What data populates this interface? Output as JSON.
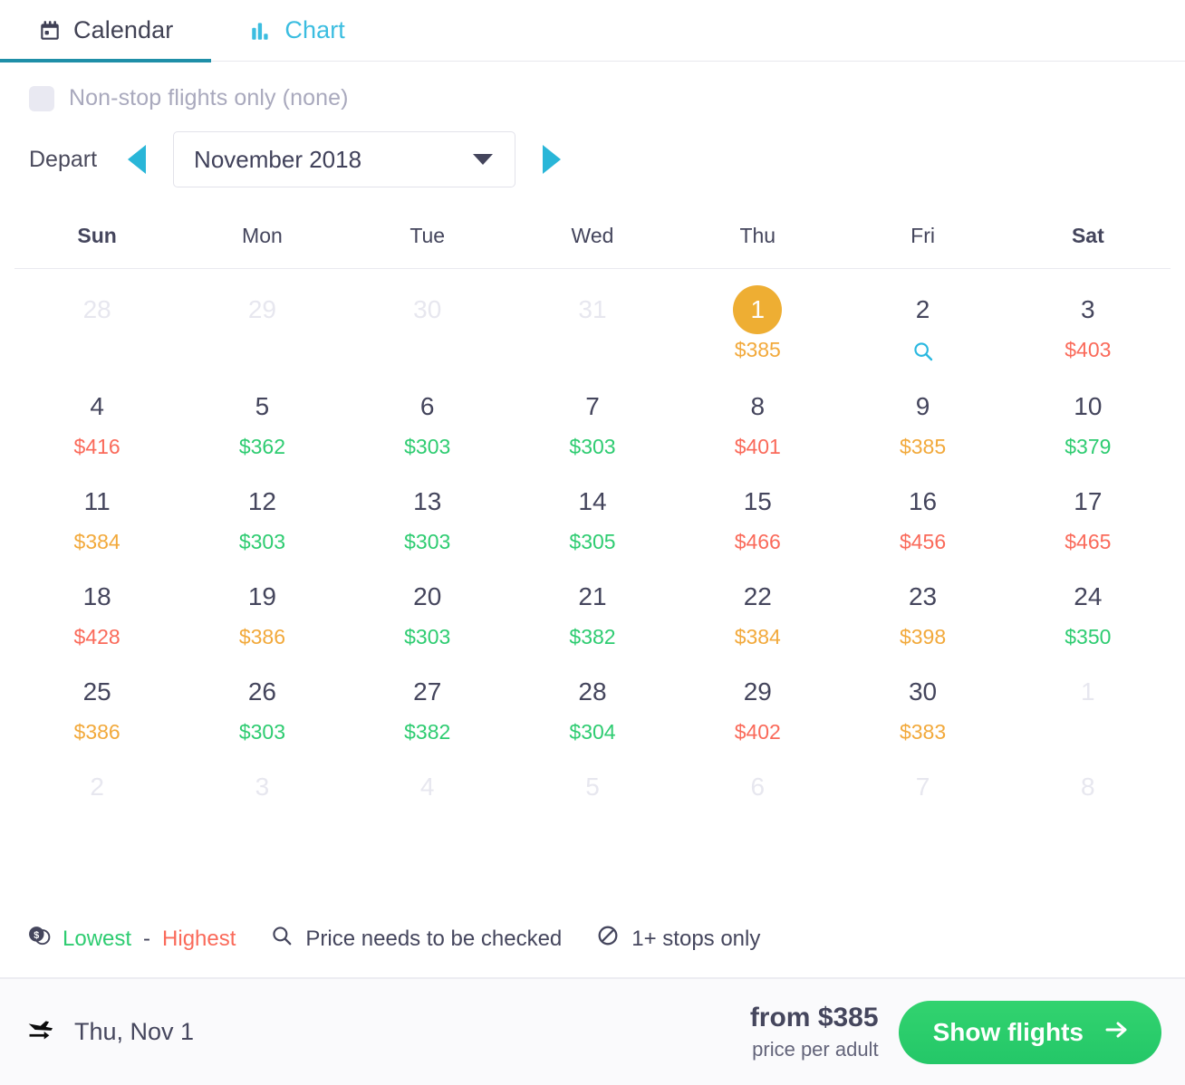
{
  "tabs": [
    {
      "label": "Calendar",
      "icon": "calendar-icon",
      "active": true
    },
    {
      "label": "Chart",
      "icon": "bar-chart-icon",
      "active": false
    }
  ],
  "filter": {
    "label": "Non-stop flights only (none)",
    "checked": false
  },
  "month_nav": {
    "depart_label": "Depart",
    "prev_icon": "triangle-left-icon",
    "next_icon": "triangle-right-icon",
    "selected_month": "November 2018",
    "caret_icon": "chevron-down-icon"
  },
  "calendar": {
    "day_headers": [
      "Sun",
      "Mon",
      "Tue",
      "Wed",
      "Thu",
      "Fri",
      "Sat"
    ],
    "weeks": [
      [
        {
          "day": "28",
          "price": "",
          "state": "muted"
        },
        {
          "day": "29",
          "price": "",
          "state": "muted"
        },
        {
          "day": "30",
          "price": "",
          "state": "muted"
        },
        {
          "day": "31",
          "price": "",
          "state": "muted"
        },
        {
          "day": "1",
          "price": "$385",
          "state": "selected",
          "tone": "sel"
        },
        {
          "day": "2",
          "price": "",
          "state": "normal",
          "icon": "search-icon"
        },
        {
          "day": "3",
          "price": "$403",
          "state": "normal",
          "tone": "high"
        }
      ],
      [
        {
          "day": "4",
          "price": "$416",
          "state": "normal",
          "tone": "high"
        },
        {
          "day": "5",
          "price": "$362",
          "state": "normal",
          "tone": "low"
        },
        {
          "day": "6",
          "price": "$303",
          "state": "normal",
          "tone": "low"
        },
        {
          "day": "7",
          "price": "$303",
          "state": "normal",
          "tone": "low"
        },
        {
          "day": "8",
          "price": "$401",
          "state": "normal",
          "tone": "high"
        },
        {
          "day": "9",
          "price": "$385",
          "state": "normal",
          "tone": "mid"
        },
        {
          "day": "10",
          "price": "$379",
          "state": "normal",
          "tone": "low"
        }
      ],
      [
        {
          "day": "11",
          "price": "$384",
          "state": "normal",
          "tone": "mid"
        },
        {
          "day": "12",
          "price": "$303",
          "state": "normal",
          "tone": "low"
        },
        {
          "day": "13",
          "price": "$303",
          "state": "normal",
          "tone": "low"
        },
        {
          "day": "14",
          "price": "$305",
          "state": "normal",
          "tone": "low"
        },
        {
          "day": "15",
          "price": "$466",
          "state": "normal",
          "tone": "high"
        },
        {
          "day": "16",
          "price": "$456",
          "state": "normal",
          "tone": "high"
        },
        {
          "day": "17",
          "price": "$465",
          "state": "normal",
          "tone": "high"
        }
      ],
      [
        {
          "day": "18",
          "price": "$428",
          "state": "normal",
          "tone": "high"
        },
        {
          "day": "19",
          "price": "$386",
          "state": "normal",
          "tone": "mid"
        },
        {
          "day": "20",
          "price": "$303",
          "state": "normal",
          "tone": "low"
        },
        {
          "day": "21",
          "price": "$382",
          "state": "normal",
          "tone": "low"
        },
        {
          "day": "22",
          "price": "$384",
          "state": "normal",
          "tone": "mid"
        },
        {
          "day": "23",
          "price": "$398",
          "state": "normal",
          "tone": "mid"
        },
        {
          "day": "24",
          "price": "$350",
          "state": "normal",
          "tone": "low"
        }
      ],
      [
        {
          "day": "25",
          "price": "$386",
          "state": "normal",
          "tone": "mid"
        },
        {
          "day": "26",
          "price": "$303",
          "state": "normal",
          "tone": "low"
        },
        {
          "day": "27",
          "price": "$382",
          "state": "normal",
          "tone": "low"
        },
        {
          "day": "28",
          "price": "$304",
          "state": "normal",
          "tone": "low"
        },
        {
          "day": "29",
          "price": "$402",
          "state": "normal",
          "tone": "high"
        },
        {
          "day": "30",
          "price": "$383",
          "state": "normal",
          "tone": "mid"
        },
        {
          "day": "1",
          "price": "",
          "state": "muted"
        }
      ],
      [
        {
          "day": "2",
          "price": "",
          "state": "muted"
        },
        {
          "day": "3",
          "price": "",
          "state": "muted"
        },
        {
          "day": "4",
          "price": "",
          "state": "muted"
        },
        {
          "day": "5",
          "price": "",
          "state": "muted"
        },
        {
          "day": "6",
          "price": "",
          "state": "muted"
        },
        {
          "day": "7",
          "price": "",
          "state": "muted"
        },
        {
          "day": "8",
          "price": "",
          "state": "muted"
        }
      ]
    ]
  },
  "legend": {
    "coins_icon": "coins-dollar-icon",
    "lowest": "Lowest",
    "dash": "-",
    "highest": "Highest",
    "search_icon": "search-icon",
    "search_text": "Price needs to be checked",
    "nostop_icon": "no-entry-icon",
    "nostop_text": "1+ stops only"
  },
  "footer": {
    "flight_icon": "plane-takeoff-icon",
    "date": "Thu, Nov 1",
    "from_price": "from $385",
    "per_adult": "price per adult",
    "button_label": "Show flights",
    "button_icon": "arrow-right-icon"
  },
  "colors": {
    "lowest": "#2ecc71",
    "highest": "#fa6a5a",
    "mid": "#f2a93b",
    "selected": "#eeae33",
    "accent_cyan": "#29b6d8",
    "tab_underline": "#1f8fa8",
    "cta_green": "#2ecc71"
  }
}
